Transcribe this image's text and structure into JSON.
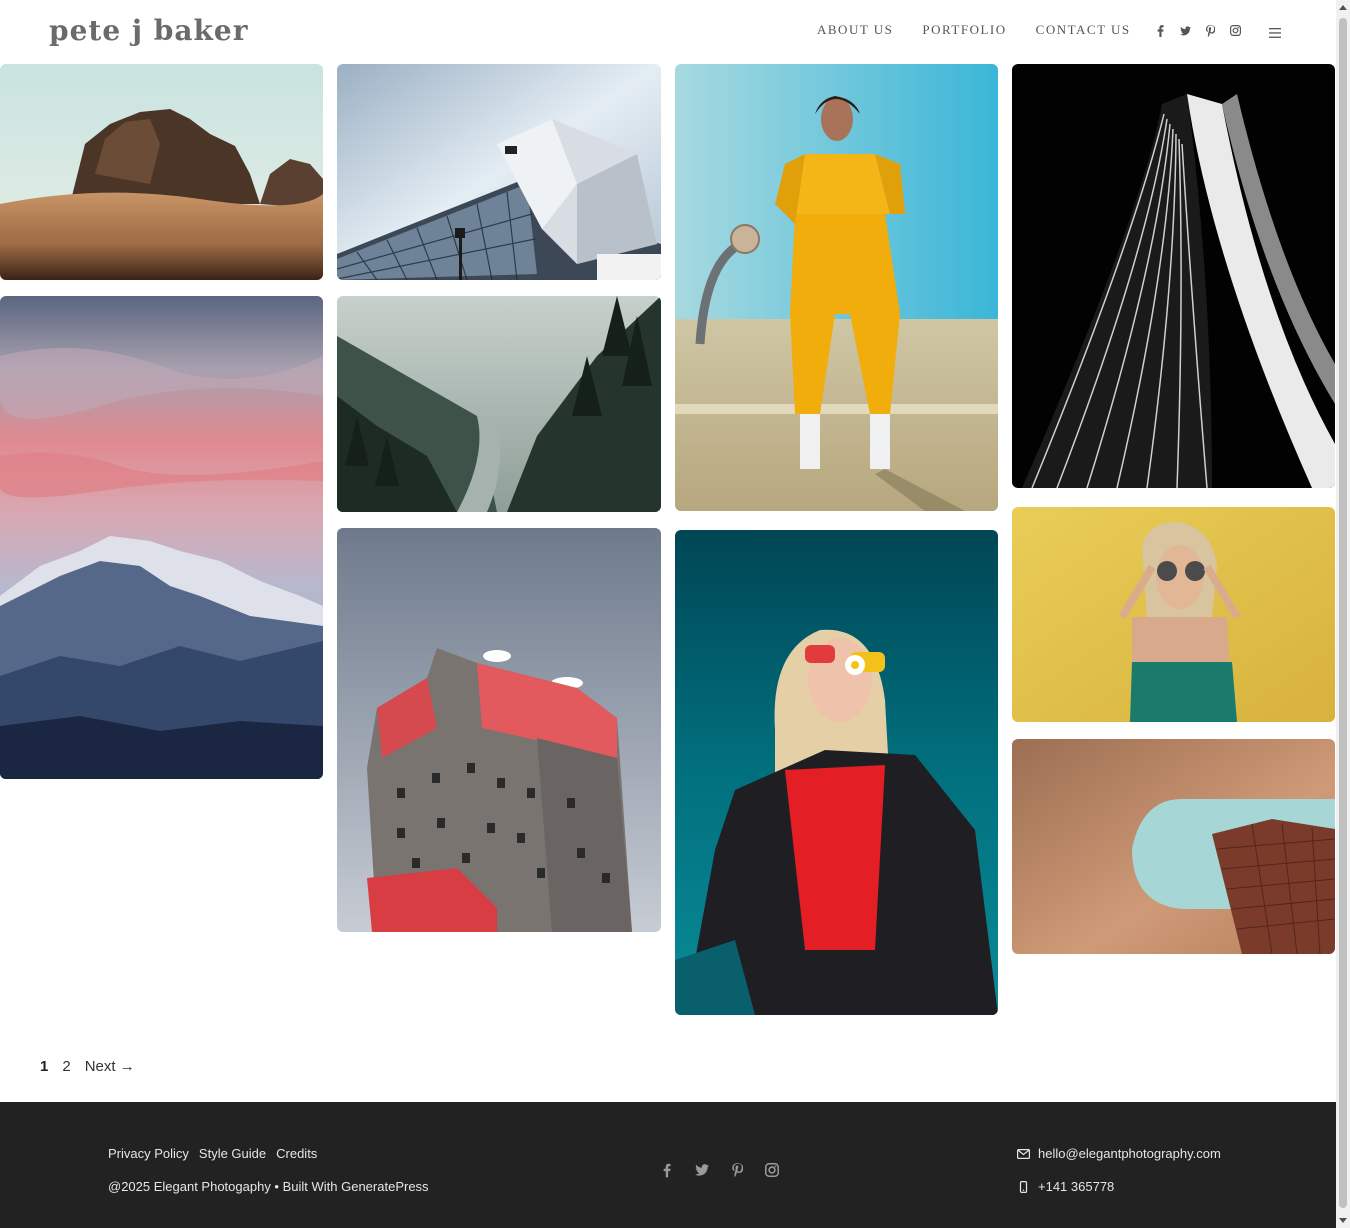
{
  "site": {
    "logo": "pete j baker"
  },
  "nav": {
    "items": [
      {
        "label": "ABOUT US"
      },
      {
        "label": "PORTFOLIO"
      },
      {
        "label": "CONTACT US"
      }
    ]
  },
  "social_icons": [
    "facebook-icon",
    "twitter-icon",
    "pinterest-icon",
    "instagram-icon"
  ],
  "gallery": {
    "images": [
      {
        "subject": "desert rock formation at sunset"
      },
      {
        "subject": "angular glass building with lamppost"
      },
      {
        "subject": "woman in yellow tracksuit near basketball hoop"
      },
      {
        "subject": "curved black and white skyscraper"
      },
      {
        "subject": "pink sunset over mountain range"
      },
      {
        "subject": "misty forest valley with river"
      },
      {
        "subject": "red and grey apartment block"
      },
      {
        "subject": "woman with flower and colorful sunglasses"
      },
      {
        "subject": "woman in sunglasses against yellow wall"
      },
      {
        "subject": "cylindrical tower through curved wall opening"
      }
    ]
  },
  "pagination": {
    "current": "1",
    "page2": "2",
    "next": "Next →"
  },
  "footer": {
    "links": [
      "Privacy Policy",
      "Style Guide",
      "Credits"
    ],
    "copyright": "@2025 Elegant Photogaphy • Built With GeneratePress",
    "email": "hello@elegantphotography.com",
    "phone": "+141 365778"
  },
  "colors": {
    "footer_bg": "#222222",
    "logo": "#6b6b6b",
    "nav_text": "#555555"
  }
}
